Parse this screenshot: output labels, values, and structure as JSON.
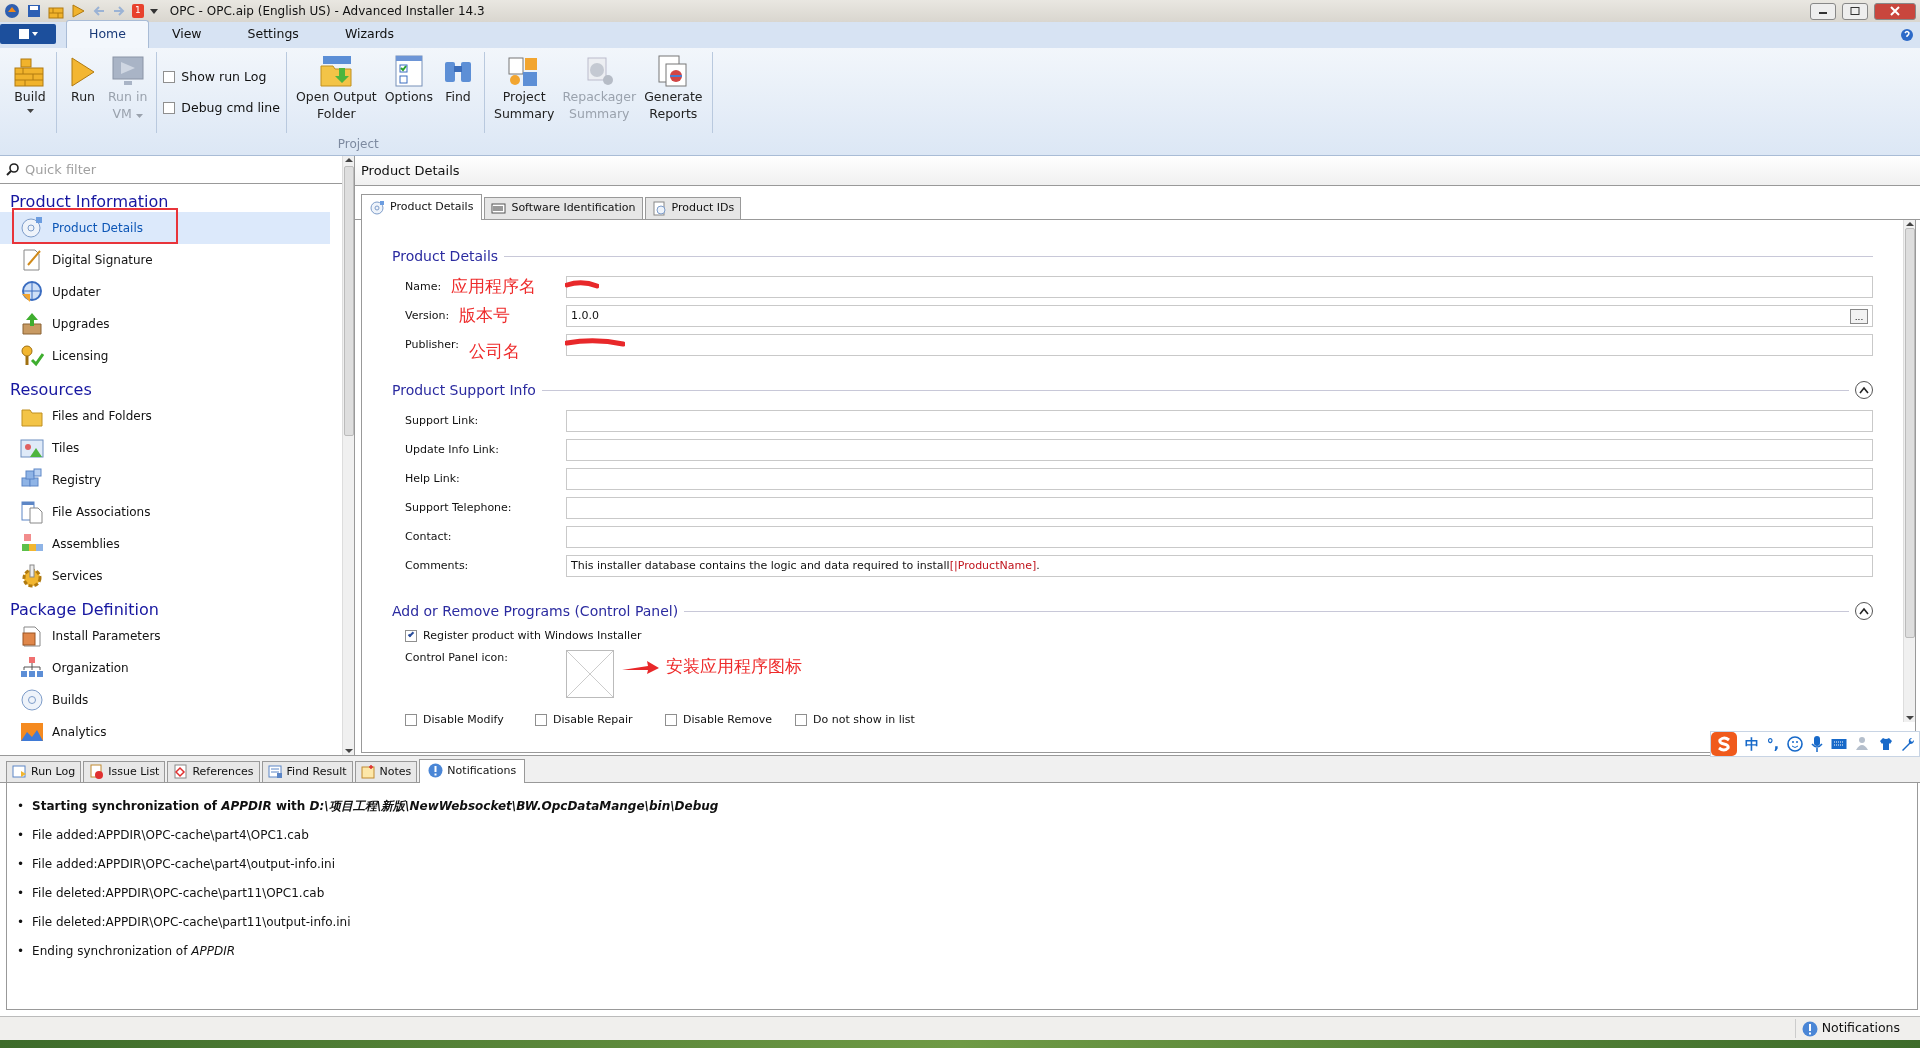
{
  "window": {
    "title": "OPC - OPC.aip (English US) - Advanced Installer 14.3"
  },
  "quick_access": {
    "badge": "1"
  },
  "ribbon": {
    "tabs": [
      {
        "label": "Home",
        "selected": true
      },
      {
        "label": "View",
        "selected": false
      },
      {
        "label": "Settings",
        "selected": false
      },
      {
        "label": "Wizards",
        "selected": false
      }
    ],
    "sections": [
      [
        {
          "kind": "button",
          "label": "Build",
          "disabled": false,
          "dropdown": true
        }
      ],
      [
        {
          "kind": "button",
          "label": "Run",
          "disabled": false,
          "dropdown": false
        },
        {
          "kind": "button",
          "label": "Run in\nVM",
          "disabled": true,
          "dropdown": true
        }
      ],
      [
        {
          "kind": "checkbox",
          "label": "Show run Log",
          "checked": false
        },
        {
          "kind": "checkbox",
          "label": "Debug cmd line",
          "checked": false
        }
      ],
      [
        {
          "kind": "button",
          "label": "Open Output\nFolder",
          "disabled": false,
          "dropdown": false
        },
        {
          "kind": "button",
          "label": "Options",
          "disabled": false,
          "dropdown": false
        },
        {
          "kind": "button",
          "label": "Find",
          "disabled": false,
          "dropdown": false
        }
      ],
      [
        {
          "kind": "button",
          "label": "Project\nSummary",
          "disabled": false,
          "dropdown": false
        },
        {
          "kind": "button",
          "label": "Repackager\nSummary",
          "disabled": true,
          "dropdown": false
        },
        {
          "kind": "button",
          "label": "Generate\nReports",
          "disabled": false,
          "dropdown": false
        }
      ]
    ],
    "group_label": "Project"
  },
  "sidebar": {
    "filter": {
      "placeholder": "Quick filter"
    },
    "sections": [
      {
        "title": "Product Information",
        "items": [
          {
            "label": "Product Details",
            "selected": true,
            "framed": true
          },
          {
            "label": "Digital Signature",
            "selected": false,
            "framed": false
          },
          {
            "label": "Updater",
            "selected": false,
            "framed": false
          },
          {
            "label": "Upgrades",
            "selected": false,
            "framed": false
          },
          {
            "label": "Licensing",
            "selected": false,
            "framed": false
          }
        ]
      },
      {
        "title": "Resources",
        "items": [
          {
            "label": "Files and Folders",
            "selected": false,
            "framed": false
          },
          {
            "label": "Tiles",
            "selected": false,
            "framed": false
          },
          {
            "label": "Registry",
            "selected": false,
            "framed": false
          },
          {
            "label": "File Associations",
            "selected": false,
            "framed": false
          },
          {
            "label": "Assemblies",
            "selected": false,
            "framed": false
          },
          {
            "label": "Services",
            "selected": false,
            "framed": false
          }
        ]
      },
      {
        "title": "Package Definition",
        "items": [
          {
            "label": "Install Parameters",
            "selected": false,
            "framed": false
          },
          {
            "label": "Organization",
            "selected": false,
            "framed": false
          },
          {
            "label": "Builds",
            "selected": false,
            "framed": false
          },
          {
            "label": "Analytics",
            "selected": false,
            "framed": false
          }
        ]
      }
    ]
  },
  "content": {
    "header": "Product Details",
    "tabs": [
      {
        "label": "Product Details",
        "selected": true
      },
      {
        "label": "Software Identification",
        "selected": false
      },
      {
        "label": "Product IDs",
        "selected": false
      }
    ],
    "sections": [
      {
        "kind": "fields",
        "title": "Product Details",
        "collapsible": false,
        "fields": [
          {
            "label": "Name:",
            "annotation": "应用程序名",
            "redacted": true
          },
          {
            "label": "Version:",
            "annotation": "版本号",
            "value": "1.0.0",
            "redacted": false,
            "browse": "..."
          },
          {
            "label": "Publisher:",
            "annotation": "公司名",
            "redacted": true
          }
        ]
      },
      {
        "kind": "fields",
        "title": "Product Support Info",
        "collapsible": true,
        "fields": [
          {
            "label": "Support Link:",
            "redacted": false
          },
          {
            "label": "Update Info Link:",
            "redacted": false
          },
          {
            "label": "Help Link:",
            "redacted": false
          },
          {
            "label": "Support Telephone:",
            "redacted": false
          },
          {
            "label": "Contact:",
            "redacted": false
          },
          {
            "label": "Comments:",
            "redacted": false,
            "segments": [
              {
                "kind": "plain",
                "text": "This installer database contains the logic and data required to install "
              },
              {
                "kind": "property",
                "text": "[|ProductName]"
              },
              {
                "kind": "plain",
                "text": "."
              }
            ]
          }
        ]
      },
      {
        "kind": "programs",
        "title": "Add or Remove Programs (Control Panel)",
        "collapsible": true,
        "register": {
          "label": "Register product with Windows Installer",
          "checked": true
        },
        "icon_label": "Control Panel icon:",
        "icon_annotation": "安装应用程序图标",
        "options": [
          {
            "label": "Disable Modify",
            "checked": false
          },
          {
            "label": "Disable Repair",
            "checked": false
          },
          {
            "label": "Disable Remove",
            "checked": false
          },
          {
            "label": "Do not show in list",
            "checked": false
          }
        ]
      }
    ]
  },
  "bottom": {
    "tabs": [
      {
        "label": "Run Log",
        "selected": false
      },
      {
        "label": "Issue List",
        "selected": false
      },
      {
        "label": "References",
        "selected": false
      },
      {
        "label": "Find Result",
        "selected": false
      },
      {
        "label": "Notes",
        "selected": false
      },
      {
        "label": "Notifications",
        "selected": true
      }
    ],
    "notifications": [
      {
        "bullet": "•",
        "text": "Starting synchronization of *APPDIR* with *D:\\项目工程\\新版\\NewWebsocket\\BW.OpcDataMange\\bin\\Debug*",
        "bold": true
      },
      {
        "bullet": "•",
        "text": "File added:APPDIR\\OPC-cache\\part4\\OPC1.cab",
        "bold": false
      },
      {
        "bullet": "•",
        "text": "File added:APPDIR\\OPC-cache\\part4\\output-info.ini",
        "bold": false
      },
      {
        "bullet": "•",
        "text": "File deleted:APPDIR\\OPC-cache\\part11\\OPC1.cab",
        "bold": false
      },
      {
        "bullet": "•",
        "text": "File deleted:APPDIR\\OPC-cache\\part11\\output-info.ini",
        "bold": false
      },
      {
        "bullet": "•",
        "text": "Ending synchronization of *APPDIR*",
        "bold": false
      }
    ]
  },
  "ime_bar": {
    "labels": [
      "中",
      "°,"
    ]
  },
  "status_bar": {
    "label": "Notifications"
  }
}
